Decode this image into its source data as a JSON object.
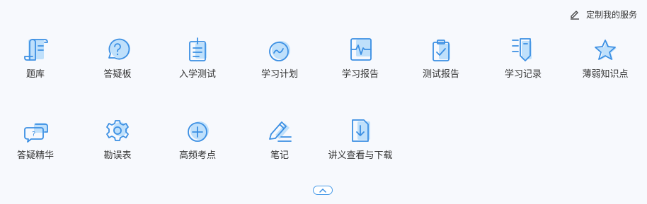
{
  "header": {
    "customize_label": "定制我的服务",
    "customize_icon": "edit-icon"
  },
  "services": {
    "row1": [
      {
        "label": "题库",
        "icon": "scroll-icon"
      },
      {
        "label": "答疑板",
        "icon": "question-bubble-icon"
      },
      {
        "label": "入学测试",
        "icon": "clipboard-lines-icon"
      },
      {
        "label": "学习计划",
        "icon": "wave-circle-icon"
      },
      {
        "label": "学习报告",
        "icon": "pulse-chart-icon"
      },
      {
        "label": "测试报告",
        "icon": "clipboard-check-icon"
      },
      {
        "label": "学习记录",
        "icon": "notebook-list-icon"
      },
      {
        "label": "薄弱知识点",
        "icon": "star-icon"
      }
    ],
    "row2": [
      {
        "label": "答疑精华",
        "icon": "chat-bubbles-icon"
      },
      {
        "label": "勘误表",
        "icon": "gear-icon"
      },
      {
        "label": "高频考点",
        "icon": "plus-circle-icon"
      },
      {
        "label": "笔记",
        "icon": "pencil-icon"
      },
      {
        "label": "讲义查看与下载",
        "icon": "download-document-icon"
      }
    ]
  },
  "collapse_icon": "chevron-up-icon",
  "colors": {
    "accent": "#3b8fe3",
    "icon_fill": "#bfe0fb",
    "text": "#333333",
    "background": "#f7f9fd"
  }
}
